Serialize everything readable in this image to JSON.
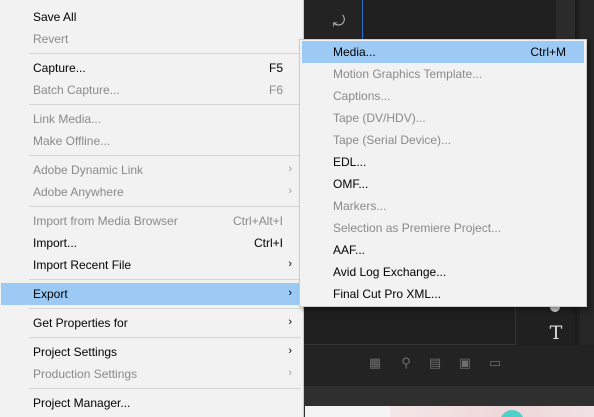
{
  "background_app": {
    "undo_icon": "undo-icon",
    "type_tool_icon": "T",
    "footer_icons": [
      "clip-icon",
      "search-icon",
      "folder-icon",
      "new-item-icon",
      "trash-icon"
    ]
  },
  "colors": {
    "menu_bg": "#f2f2f2",
    "highlight": "#9ccaf5",
    "disabled_text": "#8a8a8a",
    "app_bg": "#202020",
    "accent_blue": "#2d6fc7"
  },
  "file_menu": {
    "items": [
      {
        "label": "Save All",
        "shortcut": "",
        "enabled": true
      },
      {
        "label": "Revert",
        "shortcut": "",
        "enabled": false
      },
      {
        "label": "Capture...",
        "shortcut": "F5",
        "enabled": true
      },
      {
        "label": "Batch Capture...",
        "shortcut": "F6",
        "enabled": false
      },
      {
        "label": "Link Media...",
        "shortcut": "",
        "enabled": false
      },
      {
        "label": "Make Offline...",
        "shortcut": "",
        "enabled": false
      },
      {
        "label": "Adobe Dynamic Link",
        "arrow": "›",
        "enabled": false
      },
      {
        "label": "Adobe Anywhere",
        "arrow": "›",
        "enabled": false
      },
      {
        "label": "Import from Media Browser",
        "shortcut": "Ctrl+Alt+I",
        "enabled": false
      },
      {
        "label": "Import...",
        "shortcut": "Ctrl+I",
        "enabled": true
      },
      {
        "label": "Import Recent File",
        "arrow": "›",
        "enabled": true
      },
      {
        "label": "Export",
        "arrow": "›",
        "enabled": true,
        "highlighted": true
      },
      {
        "label": "Get Properties for",
        "arrow": "›",
        "enabled": true
      },
      {
        "label": "Project Settings",
        "arrow": "›",
        "enabled": true
      },
      {
        "label": "Production Settings",
        "arrow": "›",
        "enabled": false
      },
      {
        "label": "Project Manager...",
        "shortcut": "",
        "enabled": true
      }
    ]
  },
  "export_submenu": {
    "items": [
      {
        "label": "Media...",
        "shortcut": "Ctrl+M",
        "enabled": true,
        "highlighted": true
      },
      {
        "label": "Motion Graphics Template...",
        "enabled": false
      },
      {
        "label": "Captions...",
        "enabled": false
      },
      {
        "label": "Tape (DV/HDV)...",
        "enabled": false
      },
      {
        "label": "Tape (Serial Device)...",
        "enabled": false
      },
      {
        "label": "EDL...",
        "enabled": true
      },
      {
        "label": "OMF...",
        "enabled": true
      },
      {
        "label": "Markers...",
        "enabled": false
      },
      {
        "label": "Selection as Premiere Project...",
        "enabled": false
      },
      {
        "label": "AAF...",
        "enabled": true
      },
      {
        "label": "Avid Log Exchange...",
        "enabled": true
      },
      {
        "label": "Final Cut Pro XML...",
        "enabled": true
      }
    ]
  }
}
